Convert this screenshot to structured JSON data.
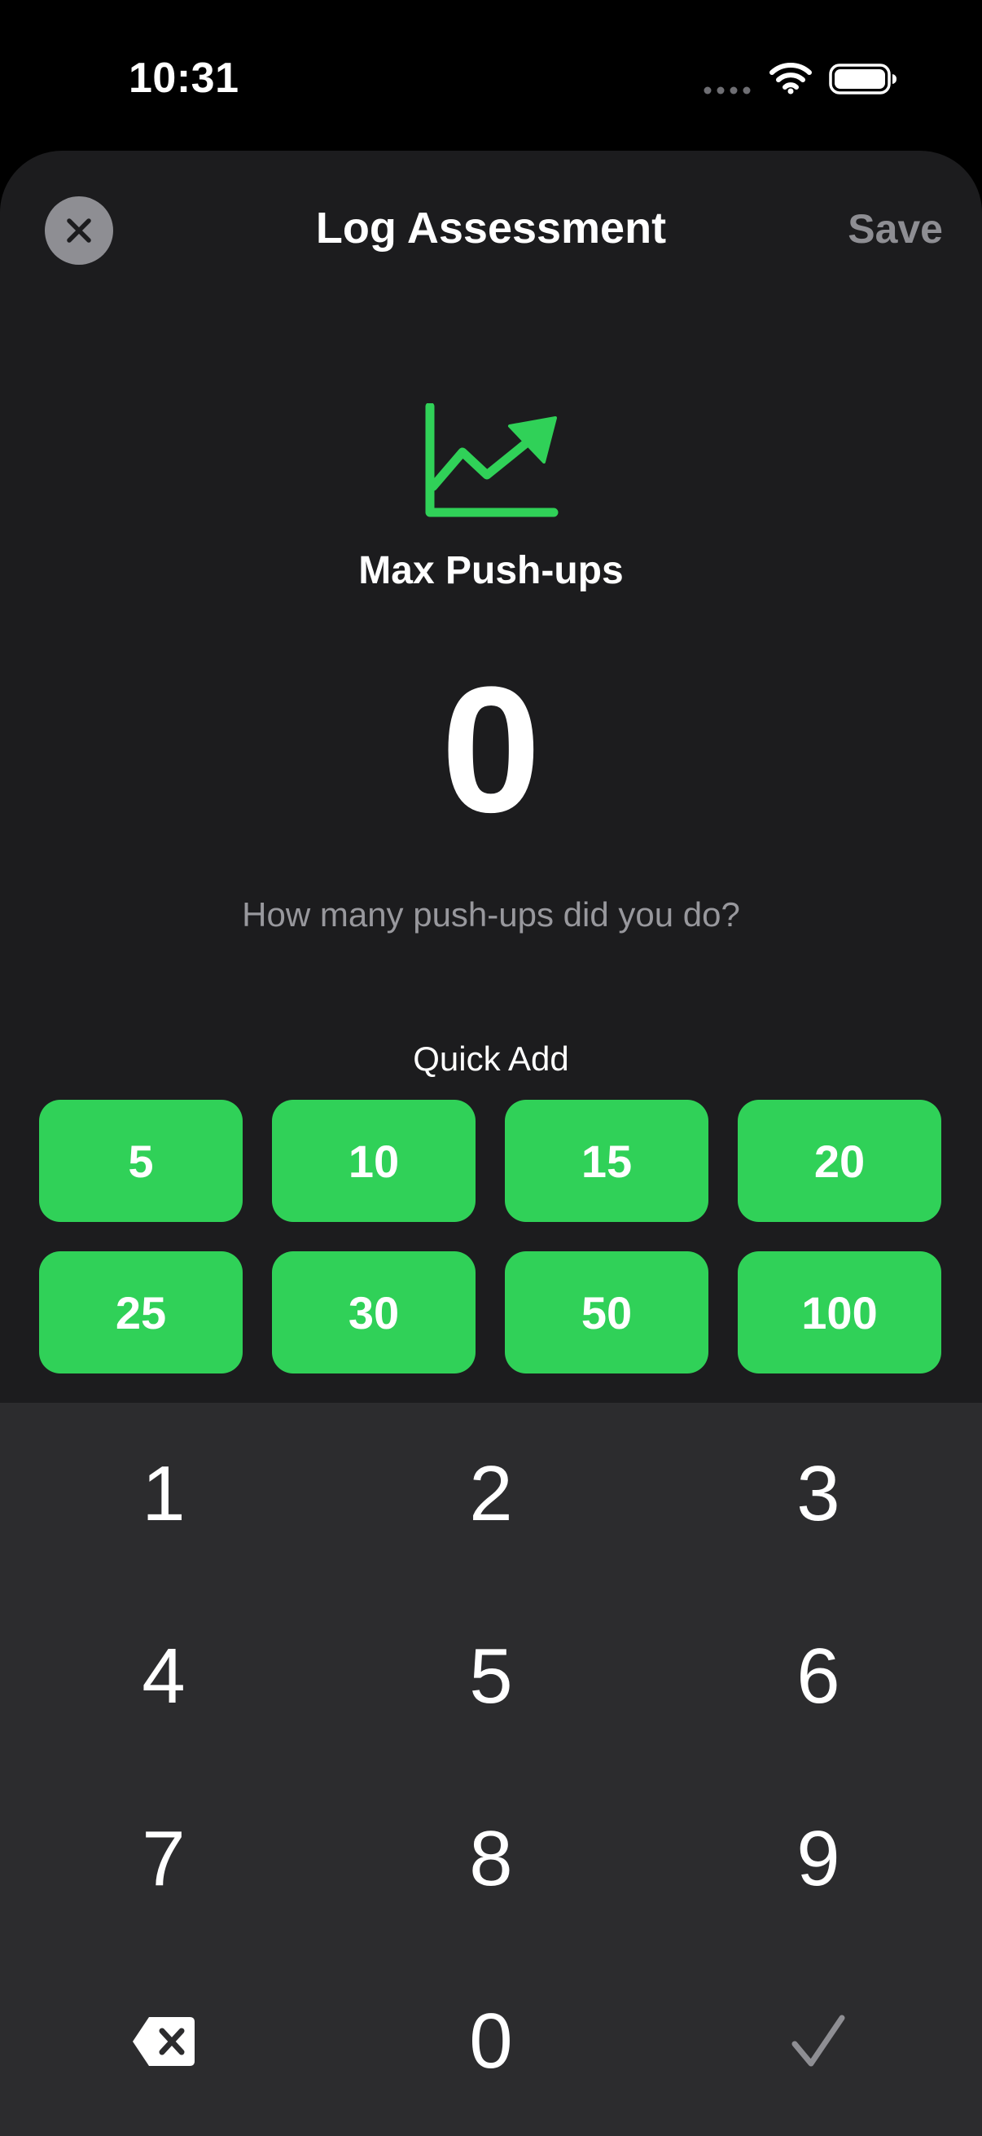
{
  "status_bar": {
    "time": "10:31"
  },
  "header": {
    "title": "Log Assessment",
    "save_label": "Save"
  },
  "assessment": {
    "exercise_name": "Max Push-ups",
    "value": "0",
    "prompt": "How many push-ups did you do?"
  },
  "quick_add": {
    "label": "Quick Add",
    "values": [
      "5",
      "10",
      "15",
      "20",
      "25",
      "30",
      "50",
      "100"
    ]
  },
  "keypad": {
    "keys": [
      "1",
      "2",
      "3",
      "4",
      "5",
      "6",
      "7",
      "8",
      "9",
      "0"
    ]
  },
  "icons": {
    "close": "close-icon",
    "chart": "chart-trend-icon",
    "delete": "delete-backspace-icon",
    "confirm": "checkmark-icon"
  },
  "colors": {
    "accent": "#30d158",
    "sheet_background": "#1c1c1e",
    "keypad_background": "#2c2c2e",
    "secondary_text": "#8e8e93"
  }
}
